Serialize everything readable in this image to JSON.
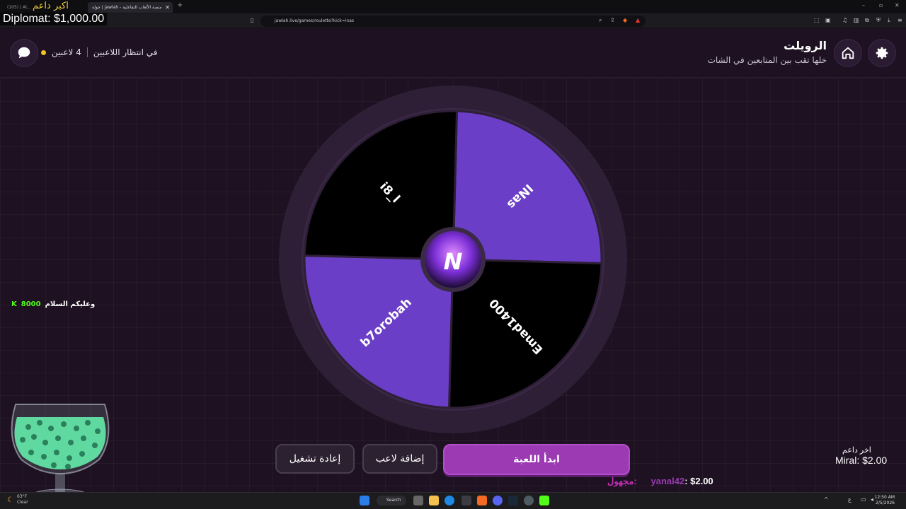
{
  "browser": {
    "tabs": [
      {
        "label": "(105) | Al..."
      },
      {
        "label": "جولة | Jawlah - منصة الألعاب التفاعلية"
      }
    ],
    "url": "jawlah.live/games/roulette?kick=inas"
  },
  "header": {
    "title": "الرويلت",
    "subtitle": "خلها تقب بين المتابعين في الشات",
    "players_count": "4 لاعبين",
    "status": "في انتظار اللاعبين"
  },
  "wheel": {
    "segments": [
      {
        "label": "INas",
        "color": "#6b3ec7"
      },
      {
        "label": "Emad1400",
        "color": "#000000"
      },
      {
        "label": "b7orobah",
        "color": "#6b3ec7"
      },
      {
        "label": "i8_l",
        "color": "#000000"
      }
    ],
    "center_logo": "N"
  },
  "buttons": {
    "start": "ابدأ اللعبة",
    "add_player": "إضافة لاعب",
    "restart": "إعادة تشغيل"
  },
  "overlay": {
    "top_donor_label": "اكبر داعم",
    "top_donor": "Diplomat: $1,000.00",
    "chat_message": "وعليكم السلام",
    "chat_amount": "8000",
    "last_donor_label": "اخر داعم",
    "last_donor": "Miral: $2.00",
    "ticker_label": "مجهول:",
    "ticker_user": "yanal42",
    "ticker_amount": ": $2.00"
  },
  "taskbar": {
    "weather_temp": "63°F",
    "weather_text": "Clear",
    "search": "Search",
    "time": "12:50 AM",
    "date": "2/5/2026",
    "lang": "ع"
  },
  "colors": {
    "accent": "#9b3ab3",
    "segment_purple": "#6b3ec7",
    "background": "#1d1122"
  }
}
